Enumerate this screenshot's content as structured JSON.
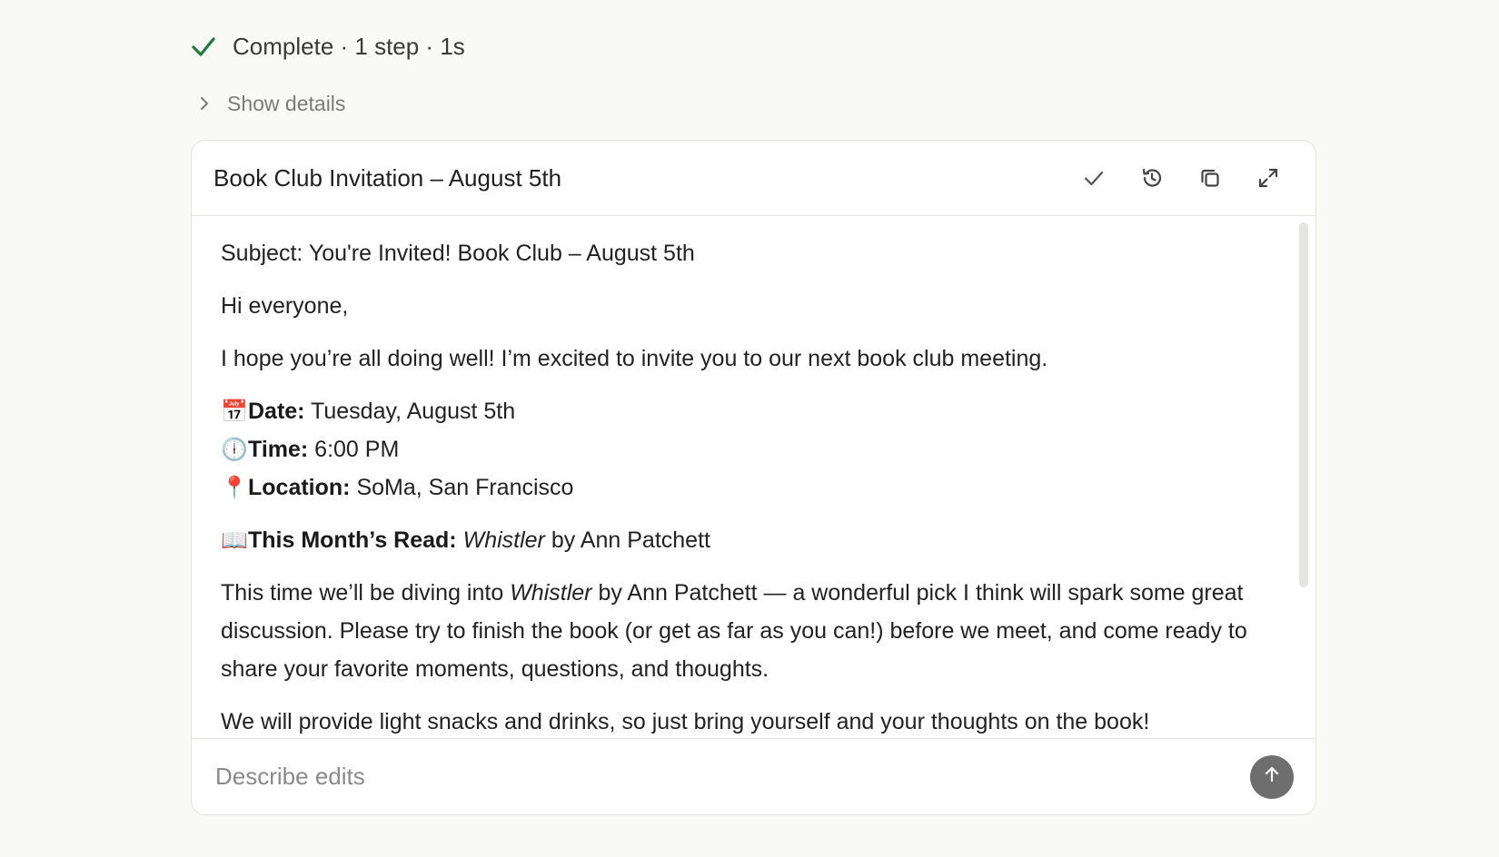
{
  "status": {
    "text": "Complete · 1 step · 1s",
    "icon": "check-icon",
    "color": "#1f7a3a"
  },
  "details_toggle": {
    "label": "Show details",
    "icon": "chevron-right-icon"
  },
  "card": {
    "title": "Book Club Invitation – August 5th",
    "actions": [
      {
        "name": "accept",
        "icon": "check-icon"
      },
      {
        "name": "history",
        "icon": "history-icon"
      },
      {
        "name": "copy",
        "icon": "copy-icon"
      },
      {
        "name": "expand",
        "icon": "expand-icon"
      }
    ],
    "body": {
      "subject": "Subject: You're Invited! Book Club – August 5th",
      "greeting": "Hi everyone,",
      "intro": "I hope you’re all doing well! I’m excited to invite you to our next book club meeting.",
      "date_emoji": "📅",
      "date_label": "Date:",
      "date_value": " Tuesday, August 5th",
      "time_emoji": "🕕",
      "time_label": "Time:",
      "time_value": " 6:00 PM",
      "location_emoji": "📍",
      "location_label": "Location:",
      "location_value": " SoMa, San Francisco",
      "read_emoji": "📖",
      "read_label": "This Month’s Read:",
      "read_title": "Whistler",
      "read_author": " by Ann Patchett",
      "para_start": "This time we’ll be diving into ",
      "para_title": "Whistler",
      "para_rest": " by Ann Patchett — a wonderful pick I think will spark some great discussion. Please try to finish the book (or get as far as you can!) before we meet, and come ready to share your favorite moments, questions, and thoughts.",
      "snacks": "We will provide light snacks and drinks, so just bring yourself and your thoughts on the book!"
    },
    "input": {
      "placeholder": "Describe edits",
      "value": ""
    },
    "send_icon": "arrow-up-icon"
  }
}
